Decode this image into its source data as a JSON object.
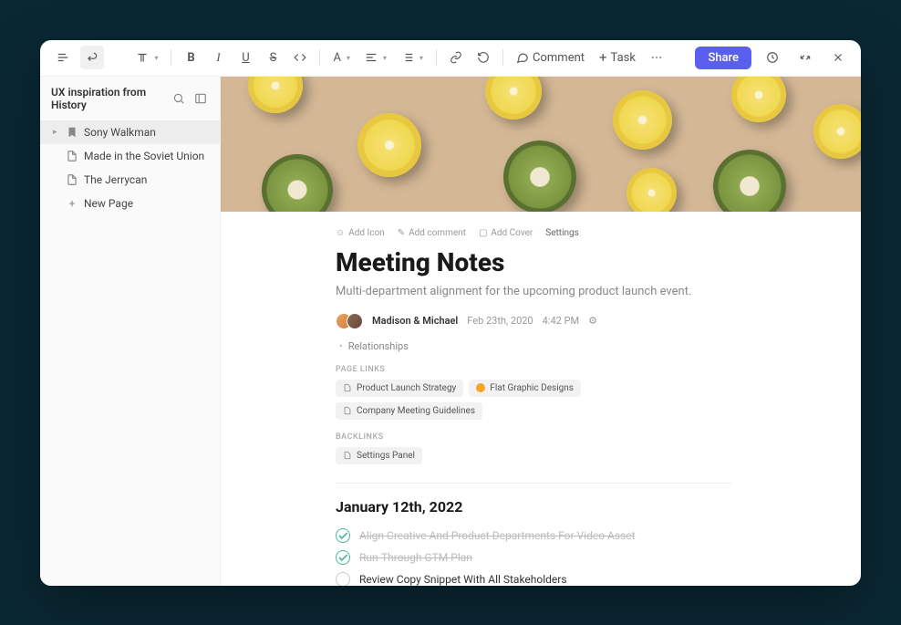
{
  "toolbar": {
    "comment": "Comment",
    "task": "Task",
    "share": "Share"
  },
  "sidebar": {
    "title": "UX inspiration from History",
    "items": [
      {
        "label": "Sony Walkman",
        "active": true,
        "icon": "bookmark"
      },
      {
        "label": "Made in the Soviet Union",
        "active": false,
        "icon": "page"
      },
      {
        "label": "The Jerrycan",
        "active": false,
        "icon": "page"
      }
    ],
    "newPage": "New Page"
  },
  "page": {
    "meta": {
      "addIcon": "Add Icon",
      "addComment": "Add comment",
      "addCover": "Add Cover",
      "settings": "Settings"
    },
    "title": "Meeting Notes",
    "subtitle": "Multi-department alignment for the upcoming product launch event.",
    "authors": "Madison & Michael",
    "date": "Feb 23th, 2020",
    "time": "4:42 PM",
    "relationships": "Relationships",
    "pageLinksLabel": "PAGE LINKS",
    "pageLinks": [
      {
        "label": "Product Launch Strategy",
        "icon": "page"
      },
      {
        "label": "Flat Graphic Designs",
        "icon": "dot-orange"
      },
      {
        "label": "Company Meeting Guidelines",
        "icon": "page"
      }
    ],
    "backlinksLabel": "BACKLINKS",
    "backlinks": [
      {
        "label": "Settings Panel",
        "icon": "page"
      }
    ],
    "dateHeading": "January 12th, 2022",
    "tasks": [
      {
        "text": "Align Creative And Product Departments For Video Asset",
        "done": true
      },
      {
        "text": "Run-Through GTM Plan",
        "done": true
      },
      {
        "text": "Review Copy Snippet With All Stakeholders",
        "done": false
      }
    ]
  }
}
